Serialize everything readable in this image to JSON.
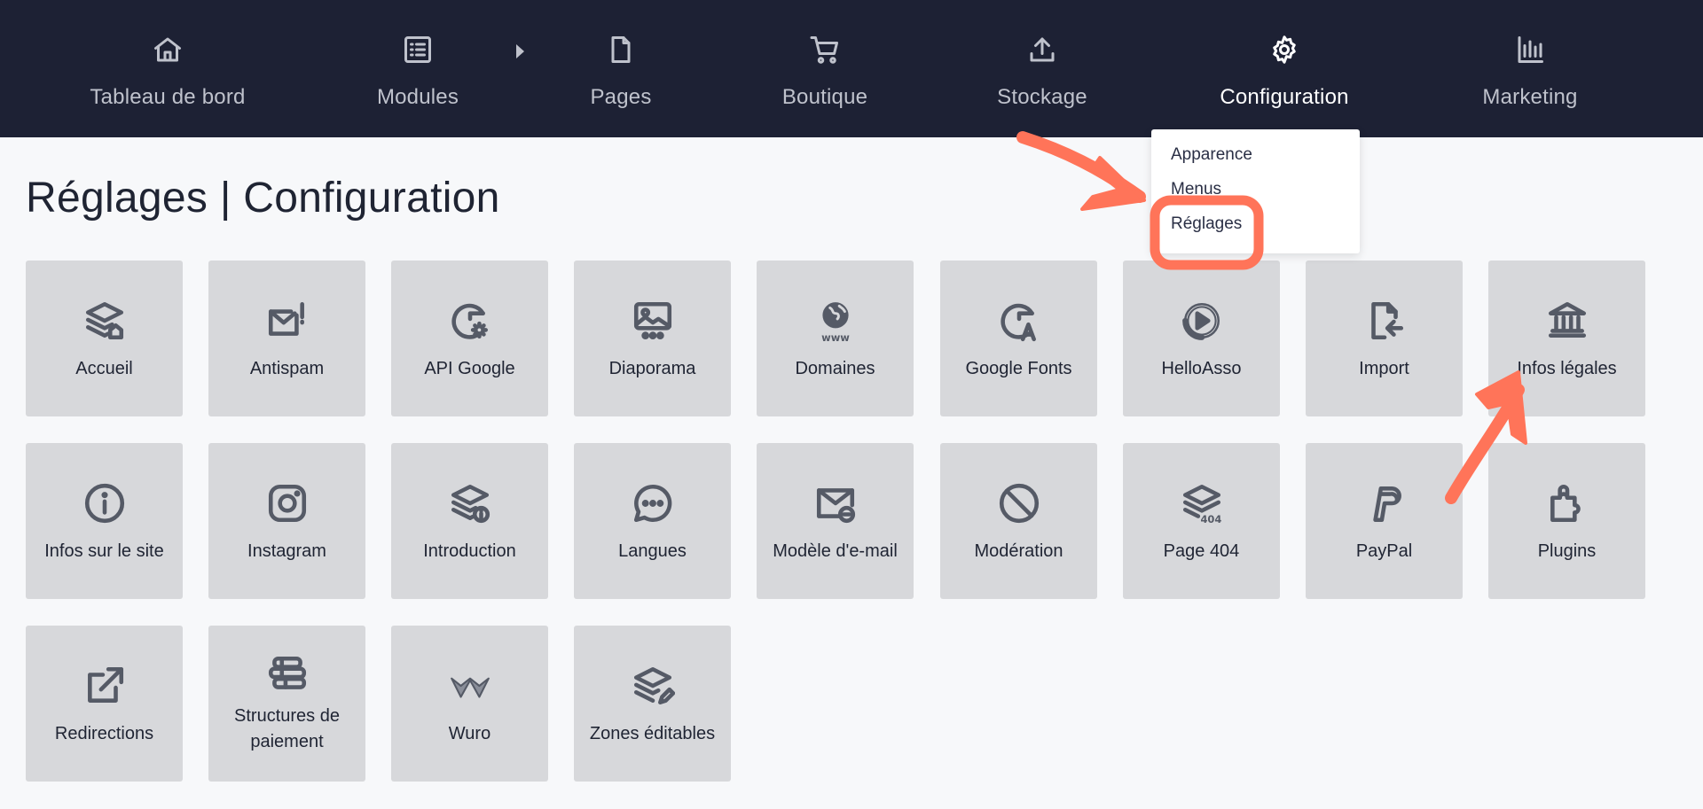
{
  "nav": {
    "items": [
      {
        "label": "Tableau de bord",
        "icon": "home-icon"
      },
      {
        "label": "Modules",
        "icon": "list-icon"
      },
      {
        "label": "Pages",
        "icon": "file-icon"
      },
      {
        "label": "Boutique",
        "icon": "cart-icon"
      },
      {
        "label": "Stockage",
        "icon": "upload-icon"
      },
      {
        "label": "Configuration",
        "icon": "gear-icon",
        "active": true
      },
      {
        "label": "Marketing",
        "icon": "bar-chart-icon"
      }
    ],
    "dropdown": [
      "Apparence",
      "Menus",
      "Réglages"
    ]
  },
  "page": {
    "title": "Réglages | Configuration"
  },
  "tiles": [
    {
      "label": "Accueil",
      "icon": "layers-home-icon"
    },
    {
      "label": "Antispam",
      "icon": "mail-alert-icon"
    },
    {
      "label": "API Google",
      "icon": "google-gear-icon"
    },
    {
      "label": "Diaporama",
      "icon": "image-slides-icon"
    },
    {
      "label": "Domaines",
      "icon": "globe-www-icon"
    },
    {
      "label": "Google Fonts",
      "icon": "google-font-icon"
    },
    {
      "label": "HelloAsso",
      "icon": "helloasso-icon"
    },
    {
      "label": "Import",
      "icon": "file-import-icon"
    },
    {
      "label": "Infos légales",
      "icon": "bank-icon"
    },
    {
      "label": "Infos sur le site",
      "icon": "info-circle-icon"
    },
    {
      "label": "Instagram",
      "icon": "instagram-icon"
    },
    {
      "label": "Introduction",
      "icon": "layers-info-icon"
    },
    {
      "label": "Langues",
      "icon": "chat-bubble-icon"
    },
    {
      "label": "Modèle d'e-mail",
      "icon": "mail-template-icon"
    },
    {
      "label": "Modération",
      "icon": "ban-icon"
    },
    {
      "label": "Page 404",
      "icon": "layers-404-icon"
    },
    {
      "label": "PayPal",
      "icon": "paypal-icon"
    },
    {
      "label": "Plugins",
      "icon": "puzzle-icon"
    },
    {
      "label": "Redirections",
      "icon": "external-link-icon"
    },
    {
      "label": "Structures de paiement",
      "icon": "database-icon"
    },
    {
      "label": "Wuro",
      "icon": "wuro-logo-icon"
    },
    {
      "label": "Zones éditables",
      "icon": "layers-edit-icon"
    }
  ],
  "colors": {
    "nav_bg": "#1d2134",
    "tile_bg": "#d7d8db",
    "annotation": "#ff7459"
  }
}
